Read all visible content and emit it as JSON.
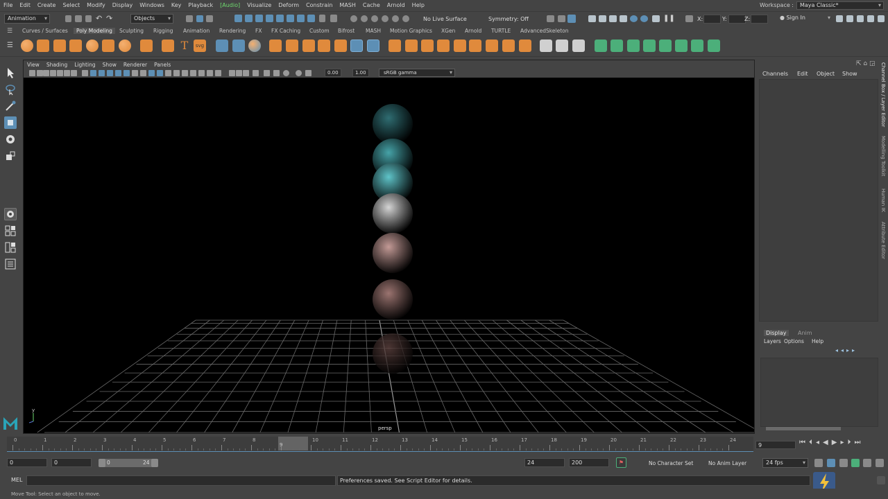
{
  "menubar": {
    "items": [
      "File",
      "Edit",
      "Create",
      "Select",
      "Modify",
      "Display",
      "Windows",
      "Key",
      "Playback",
      "[Audio]",
      "Visualize",
      "Deform",
      "Constrain",
      "MASH",
      "Cache",
      "Arnold",
      "Help"
    ],
    "workspace_label": "Workspace :",
    "workspace_value": "Maya Classic*"
  },
  "statusline": {
    "menu_set": "Animation",
    "selection_mode": "Objects",
    "live_surface": "No Live Surface",
    "symmetry": "Symmetry: Off",
    "x_label": "X:",
    "y_label": "Y:",
    "z_label": "Z:",
    "sign_in": "Sign In"
  },
  "shelf": {
    "tabs": [
      "Curves / Surfaces",
      "Poly Modeling",
      "Sculpting",
      "Rigging",
      "Animation",
      "Rendering",
      "FX",
      "FX Caching",
      "Custom",
      "Bifrost",
      "MASH",
      "Motion Graphics",
      "XGen",
      "Arnold",
      "TURTLE",
      "AdvancedSkeleton"
    ],
    "active_tab": "Poly Modeling",
    "text_icon": "T",
    "svg_icon": "svg"
  },
  "viewport": {
    "menus": [
      "View",
      "Shading",
      "Lighting",
      "Show",
      "Renderer",
      "Panels"
    ],
    "exposure": "0.00",
    "gamma": "1.00",
    "color_space": "sRGB gamma",
    "camera_label": "persp",
    "axis_label": "y",
    "spheres": [
      {
        "color": "#2f6d72"
      },
      {
        "color": "#46a3a8"
      },
      {
        "color": "#5fc4c9"
      },
      {
        "color": "#d5d5d5"
      },
      {
        "color": "#c39a96"
      },
      {
        "color": "#9b7470"
      },
      {
        "color": "#5e4340"
      }
    ]
  },
  "channelbox": {
    "menus": [
      "Channels",
      "Edit",
      "Object",
      "Show"
    ]
  },
  "layerbox": {
    "tabs": [
      "Display",
      "Anim"
    ],
    "menus": [
      "Layers",
      "Options",
      "Help"
    ]
  },
  "side_tabs": [
    "Channel Box / Layer Editor",
    "Modelling Toolkit",
    "Human IK",
    "Attribute Editor"
  ],
  "timeslider": {
    "ticks": [
      "0",
      "1",
      "2",
      "3",
      "4",
      "5",
      "6",
      "7",
      "8",
      "9",
      "10",
      "11",
      "12",
      "13",
      "14",
      "15",
      "16",
      "17",
      "18",
      "19",
      "20",
      "21",
      "22",
      "23",
      "24"
    ],
    "current_frame": "9",
    "current_frame_field": "9"
  },
  "rangeslider": {
    "scene_start": "0",
    "range_start": "0",
    "handle_start": "0",
    "handle_end": "24",
    "range_end": "24",
    "scene_end": "200",
    "character_set": "No Character Set",
    "anim_layer": "No Anim Layer",
    "fps": "24 fps"
  },
  "cmdline": {
    "label": "MEL",
    "result": "Preferences saved. See Script Editor for details."
  },
  "helpline": {
    "text": "Move Tool: Select an object to move."
  },
  "colors": {
    "accent": "#5d8fb5",
    "shelf_orange": "#e08a3c",
    "shelf_green": "#4caf7a",
    "audio_green": "#6fdc6f"
  }
}
